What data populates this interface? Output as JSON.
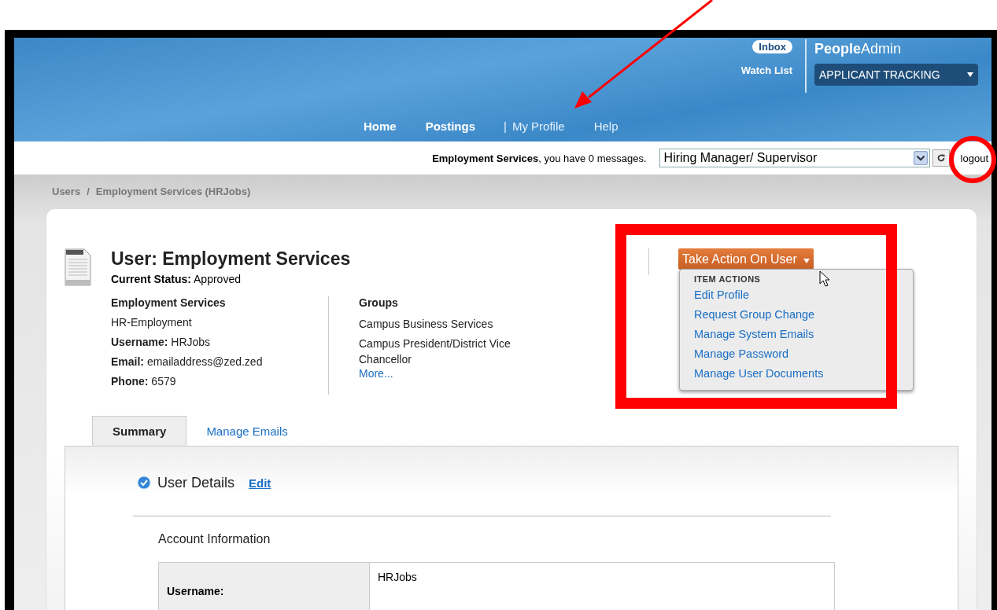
{
  "header": {
    "inbox": "Inbox",
    "watch_list": "Watch List",
    "brand": {
      "bold": "People",
      "light": "Admin"
    },
    "module_select": "APPLICANT TRACKING",
    "nav": [
      {
        "label": "Home",
        "kind": "bold"
      },
      {
        "label": "Postings",
        "kind": "bold"
      },
      {
        "label": "|",
        "kind": "separator"
      },
      {
        "label": "My Profile",
        "kind": "plain"
      },
      {
        "label": "Help",
        "kind": "plain"
      }
    ]
  },
  "user_bar": {
    "name": "Employment Services",
    "message": ", you have 0 messages.",
    "role_select": "Hiring Manager/ Supervisor",
    "logout": "logout"
  },
  "breadcrumb": [
    "Users",
    "/",
    "Employment Services (HRJobs)"
  ],
  "user": {
    "title": "User: Employment Services",
    "status_label": "Current Status:",
    "status": "Approved",
    "details": [
      {
        "kind": "heading",
        "text": "Employment Services"
      },
      {
        "kind": "plain",
        "text": "HR-Employment"
      },
      {
        "kind": "field",
        "label": "Username:",
        "value": "HRJobs"
      },
      {
        "kind": "field",
        "label": "Email:",
        "value": "emailaddress@zed.zed"
      },
      {
        "kind": "field",
        "label": "Phone:",
        "value": "6579"
      }
    ],
    "groups_heading": "Groups",
    "groups": [
      "Campus Business Services",
      "Campus President/District Vice Chancellor"
    ],
    "more": "More..."
  },
  "action_menu": {
    "button": "Take Action On User",
    "section": "ITEM ACTIONS",
    "items": [
      "Edit Profile",
      "Request Group Change",
      "Manage System Emails",
      "Manage Password",
      "Manage User Documents"
    ]
  },
  "tabs": [
    {
      "label": "Summary",
      "selected": true
    },
    {
      "label": "Manage Emails",
      "selected": false
    }
  ],
  "section": {
    "title": "User Details",
    "edit": "Edit",
    "subtitle": "Account Information",
    "rows": [
      {
        "label": "Username:",
        "value": "HRJobs"
      }
    ]
  }
}
